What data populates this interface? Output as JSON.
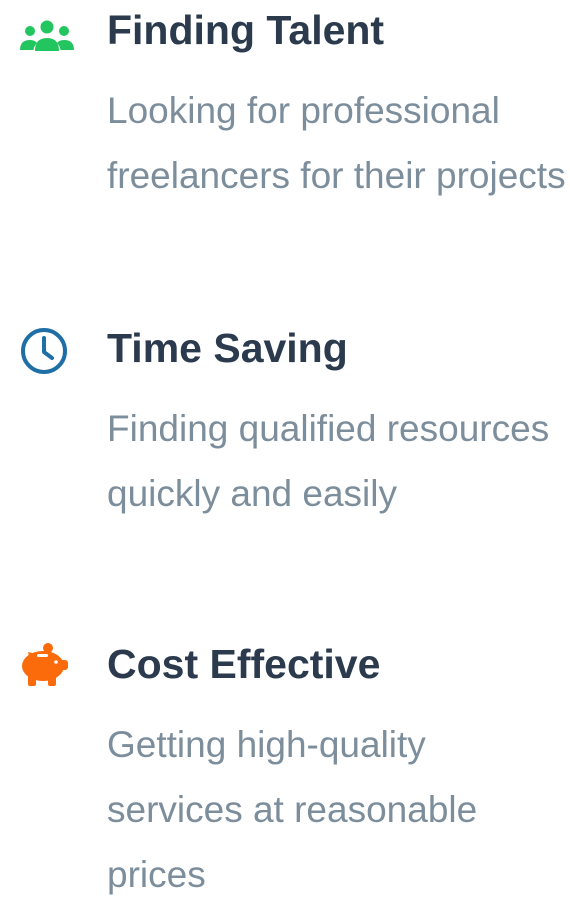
{
  "colors": {
    "title": "#2b3a4d",
    "description": "#7c8d9b",
    "icon_talent": "#22c55e",
    "icon_time": "#1f6fa6",
    "icon_cost": "#fb6a0b"
  },
  "features": [
    {
      "icon": "users-icon",
      "title": "Finding Talent",
      "description": "Looking for professional freelancers for their projects"
    },
    {
      "icon": "clock-icon",
      "title": "Time Saving",
      "description": "Finding qualified resources quickly and easily"
    },
    {
      "icon": "piggy-bank-icon",
      "title": "Cost Effective",
      "description": "Getting high-quality services at reasonable prices"
    }
  ]
}
